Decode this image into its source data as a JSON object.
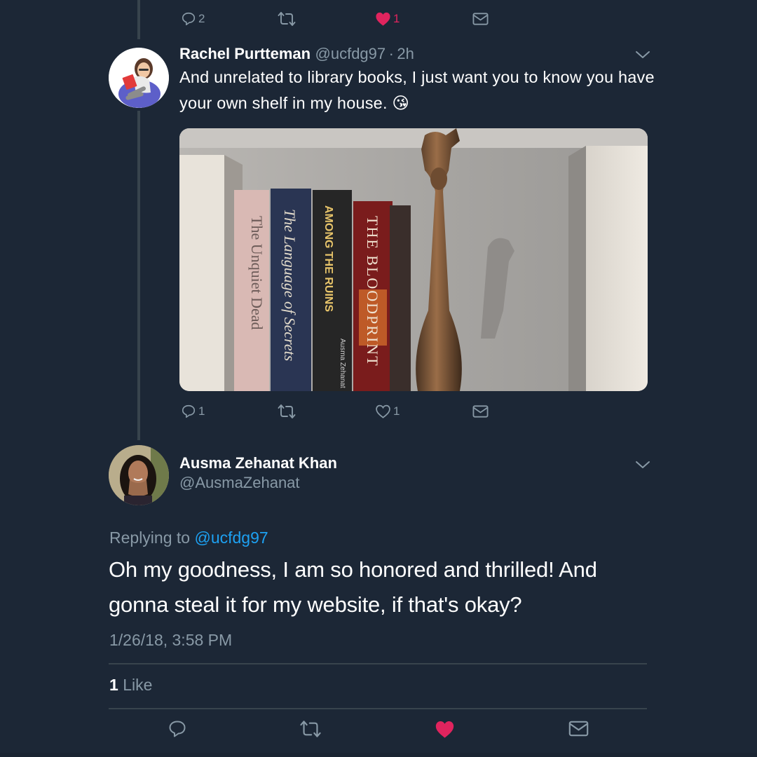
{
  "top_tweet": {
    "reply_count": "2",
    "like_count": "1",
    "colors": {
      "liked": "#e0245e"
    }
  },
  "rachel_tweet": {
    "name": "Rachel Purtteman",
    "handle": "@ucfdg97",
    "separator": "·",
    "time": "2h",
    "text": "And unrelated to library books, I just want you to know you have your own shelf in my house.",
    "emoji": "😘",
    "avatar_icon": "bitmoji-reading-avatar",
    "reply_count": "1",
    "like_count": "1",
    "photo": {
      "book_titles": [
        "The Unquiet Dead",
        "The Language of Secrets",
        "AMONG THE RUINS",
        "THE BLOODPRINT"
      ],
      "book_author_spine": "Ausma Zehanat"
    }
  },
  "main_tweet": {
    "name": "Ausma Zehanat Khan",
    "handle": "@AusmaZehanat",
    "replying_prefix": "Replying to",
    "replying_handle": "@ucfdg97",
    "text": "Oh my goodness, I am so honored and thrilled! And gonna steal it for my website, if that's okay?",
    "timestamp": "1/26/18, 3:58 PM",
    "likes_count": "1",
    "likes_label": "Like",
    "colors": {
      "link": "#1da1f2",
      "liked": "#e0245e",
      "muted": "#8899a6"
    }
  }
}
